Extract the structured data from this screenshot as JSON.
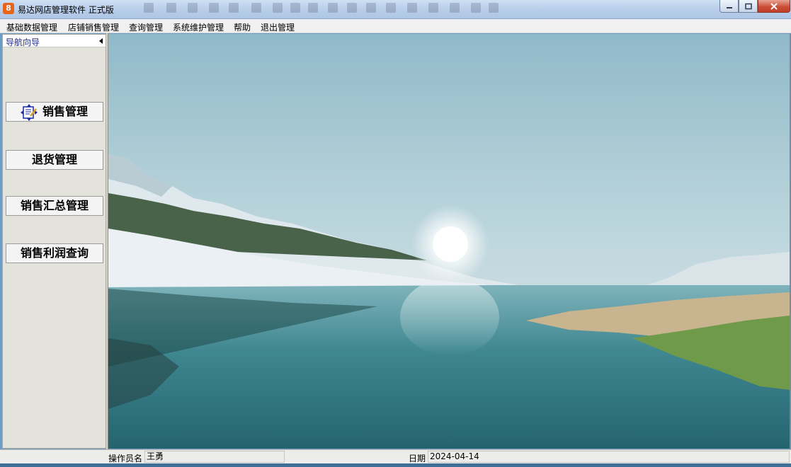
{
  "window": {
    "title": "易达网店管理软件  正式版",
    "app_icon_glyph": "8"
  },
  "menu": {
    "items": [
      "基础数据管理",
      "店铺销售管理",
      "查询管理",
      "系统维护管理",
      "帮助",
      "退出管理"
    ]
  },
  "sidebar": {
    "title": "导航向导",
    "buttons": [
      "销售管理",
      "退货管理",
      "销售汇总管理",
      "销售利润查询"
    ]
  },
  "status": {
    "operator_label": "操作员名",
    "operator_value": "王勇",
    "date_label": "日期",
    "date_value": "2024-04-14"
  },
  "colors": {
    "accent_icon": "#e8641a",
    "sidebar_title": "#1c2a8a",
    "close_button": "#c84b32"
  }
}
